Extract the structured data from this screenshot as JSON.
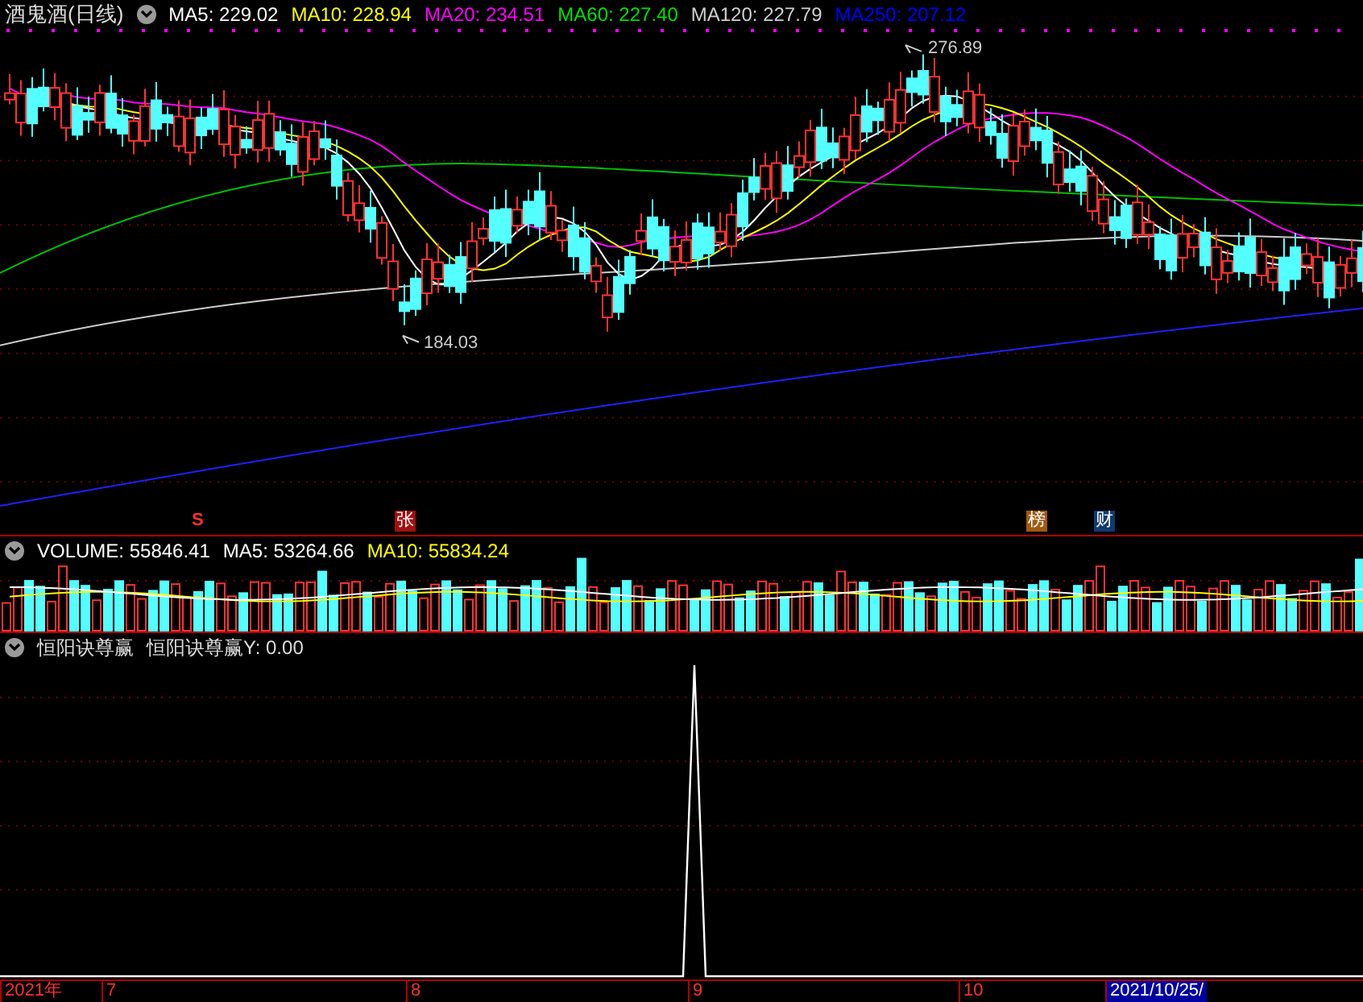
{
  "main_panel": {
    "title": "酒鬼酒(日线)",
    "indicators": [
      {
        "label": "MA5: 229.02",
        "color": "#ffffff"
      },
      {
        "label": "MA10: 228.94",
        "color": "#ffff00"
      },
      {
        "label": "MA20: 234.51",
        "color": "#ff00ff"
      },
      {
        "label": "MA60: 227.40",
        "color": "#00e000"
      },
      {
        "label": "MA120: 227.79",
        "color": "#d0d0d0"
      },
      {
        "label": "MA250: 207.12",
        "color": "#0000ff"
      }
    ],
    "high_label": "276.89",
    "low_label": "184.03",
    "markers": [
      {
        "text": "S",
        "kind": "signal",
        "color": "#ff3030"
      },
      {
        "text": "张",
        "kind": "tag",
        "color": "#a01010"
      },
      {
        "text": "榜",
        "kind": "tag",
        "color": "#a05a10"
      },
      {
        "text": "财",
        "kind": "tag",
        "color": "#103a70"
      }
    ]
  },
  "volume_panel": {
    "indicators": [
      {
        "label": "VOLUME: 55846.41",
        "color": "#ffffff"
      },
      {
        "label": "MA5: 53264.66",
        "color": "#ffffff"
      },
      {
        "label": "MA10: 55834.24",
        "color": "#ffff00"
      }
    ]
  },
  "indicator_panel": {
    "name": "恒阳诀尊赢",
    "value": "恒阳诀尊赢Y: 0.00"
  },
  "time_axis": [
    {
      "label": "2021年",
      "selected": false
    },
    {
      "label": "7",
      "selected": false
    },
    {
      "label": "8",
      "selected": false
    },
    {
      "label": "9",
      "selected": false
    },
    {
      "label": "10",
      "selected": false
    },
    {
      "label": "2021/10/25/",
      "selected": true
    }
  ]
}
